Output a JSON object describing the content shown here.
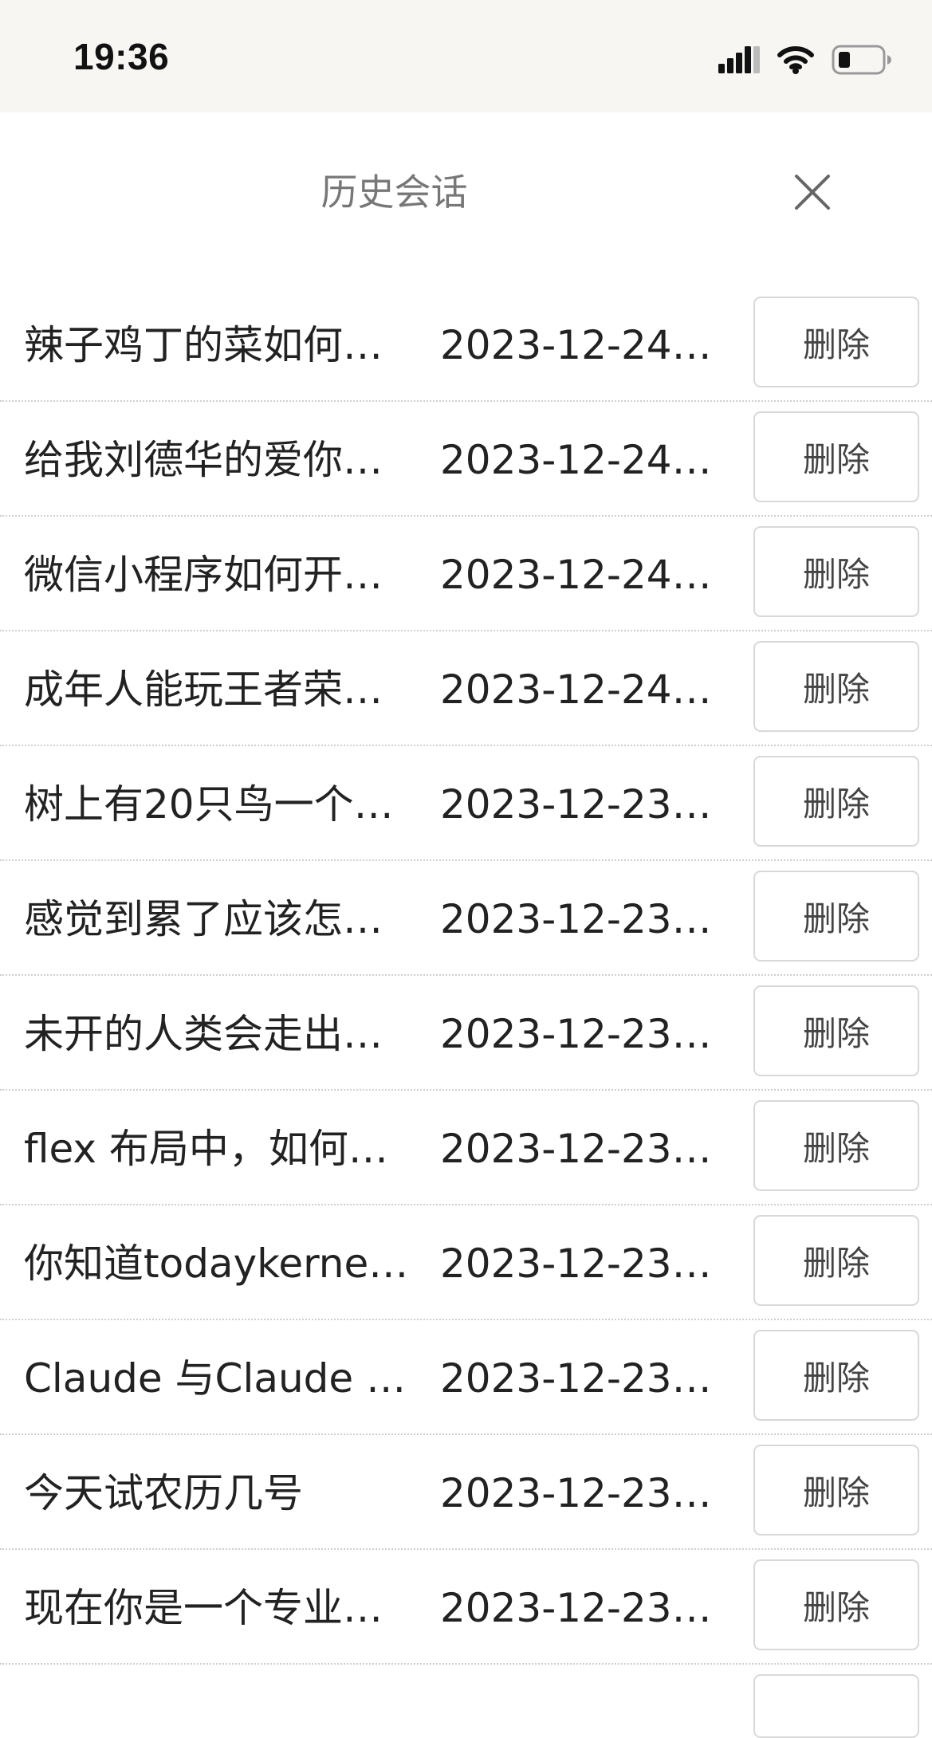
{
  "status_bar": {
    "time": "19:36",
    "icons": [
      "signal-icon",
      "wifi-icon",
      "battery-icon"
    ]
  },
  "header": {
    "title": "历史会话",
    "close_icon": "close-icon"
  },
  "conversations": [
    {
      "title": "辣子鸡丁的菜如何…",
      "date": "2023-12-24T…",
      "delete_label": "删除"
    },
    {
      "title": "给我刘德华的爱你…",
      "date": "2023-12-24T…",
      "delete_label": "删除"
    },
    {
      "title": "微信小程序如何开…",
      "date": "2023-12-24T…",
      "delete_label": "删除"
    },
    {
      "title": "成年人能玩王者荣…",
      "date": "2023-12-24T…",
      "delete_label": "删除"
    },
    {
      "title": "树上有20只鸟一个…",
      "date": "2023-12-23T…",
      "delete_label": "删除"
    },
    {
      "title": "感觉到累了应该怎…",
      "date": "2023-12-23T…",
      "delete_label": "删除"
    },
    {
      "title": "未开的人类会走出…",
      "date": "2023-12-23T…",
      "delete_label": "删除"
    },
    {
      "title": "flex 布局中，如何…",
      "date": "2023-12-23T…",
      "delete_label": "删除"
    },
    {
      "title": "你知道todaykernel…",
      "date": "2023-12-23T…",
      "delete_label": "删除"
    },
    {
      "title": "Claude 与Claude I…",
      "date": "2023-12-23T…",
      "delete_label": "删除"
    },
    {
      "title": "今天试农历几号",
      "date": "2023-12-23T…",
      "delete_label": "删除"
    },
    {
      "title": "现在你是一个专业…",
      "date": "2023-12-23T…",
      "delete_label": "删除"
    }
  ]
}
